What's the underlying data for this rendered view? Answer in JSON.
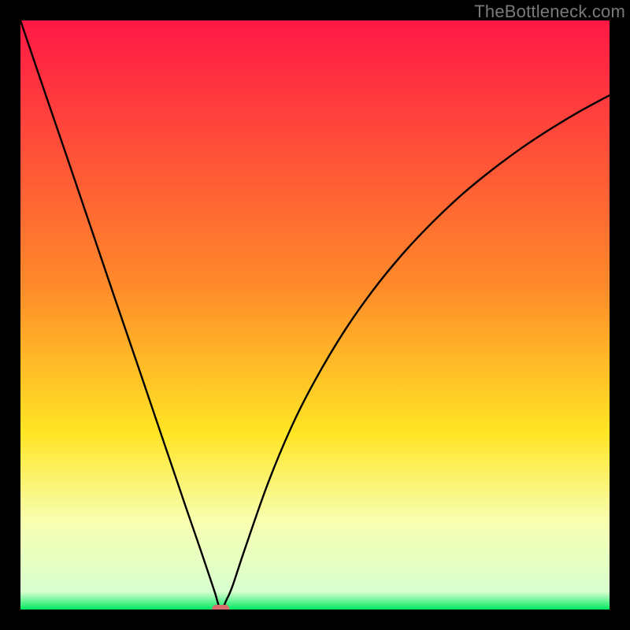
{
  "watermark": "TheBottleneck.com",
  "colors": {
    "gradient_top": "#ff1846",
    "gradient_mid_upper": "#ff8a2a",
    "gradient_mid": "#ffe524",
    "gradient_lower": "#f8ffb0",
    "gradient_bottom": "#00e861",
    "curve": "#000000",
    "marker": "#d96d6d",
    "frame_bg": "#000000"
  },
  "chart_data": {
    "type": "line",
    "title": "",
    "xlabel": "",
    "ylabel": "",
    "xlim": [
      0,
      100
    ],
    "ylim": [
      0,
      100
    ],
    "grid": false,
    "legend": false,
    "series": [
      {
        "name": "bottleneck-curve",
        "x": [
          0,
          4,
          8,
          12,
          16,
          20,
          24,
          28,
          30,
          32,
          33,
          34,
          35,
          36,
          38,
          42,
          46,
          50,
          55,
          60,
          65,
          70,
          75,
          80,
          85,
          90,
          95,
          100
        ],
        "y": [
          100,
          88.2,
          76.5,
          64.7,
          52.9,
          41.2,
          29.4,
          17.6,
          11.8,
          5.9,
          2.9,
          0,
          1.7,
          4.0,
          10.0,
          21.4,
          31.0,
          38.9,
          47.3,
          54.4,
          60.5,
          65.8,
          70.5,
          74.6,
          78.3,
          81.6,
          84.6,
          87.3
        ]
      }
    ],
    "annotations": [
      {
        "name": "minimum-marker",
        "x": 34,
        "y": 0
      }
    ],
    "background_gradient_stops": [
      {
        "pct": 0,
        "color": "#ff1846"
      },
      {
        "pct": 45,
        "color": "#ff8a2a"
      },
      {
        "pct": 70,
        "color": "#ffe524"
      },
      {
        "pct": 85,
        "color": "#f8ffb0"
      },
      {
        "pct": 97,
        "color": "#d8ffd0"
      },
      {
        "pct": 100,
        "color": "#00e861"
      }
    ]
  }
}
